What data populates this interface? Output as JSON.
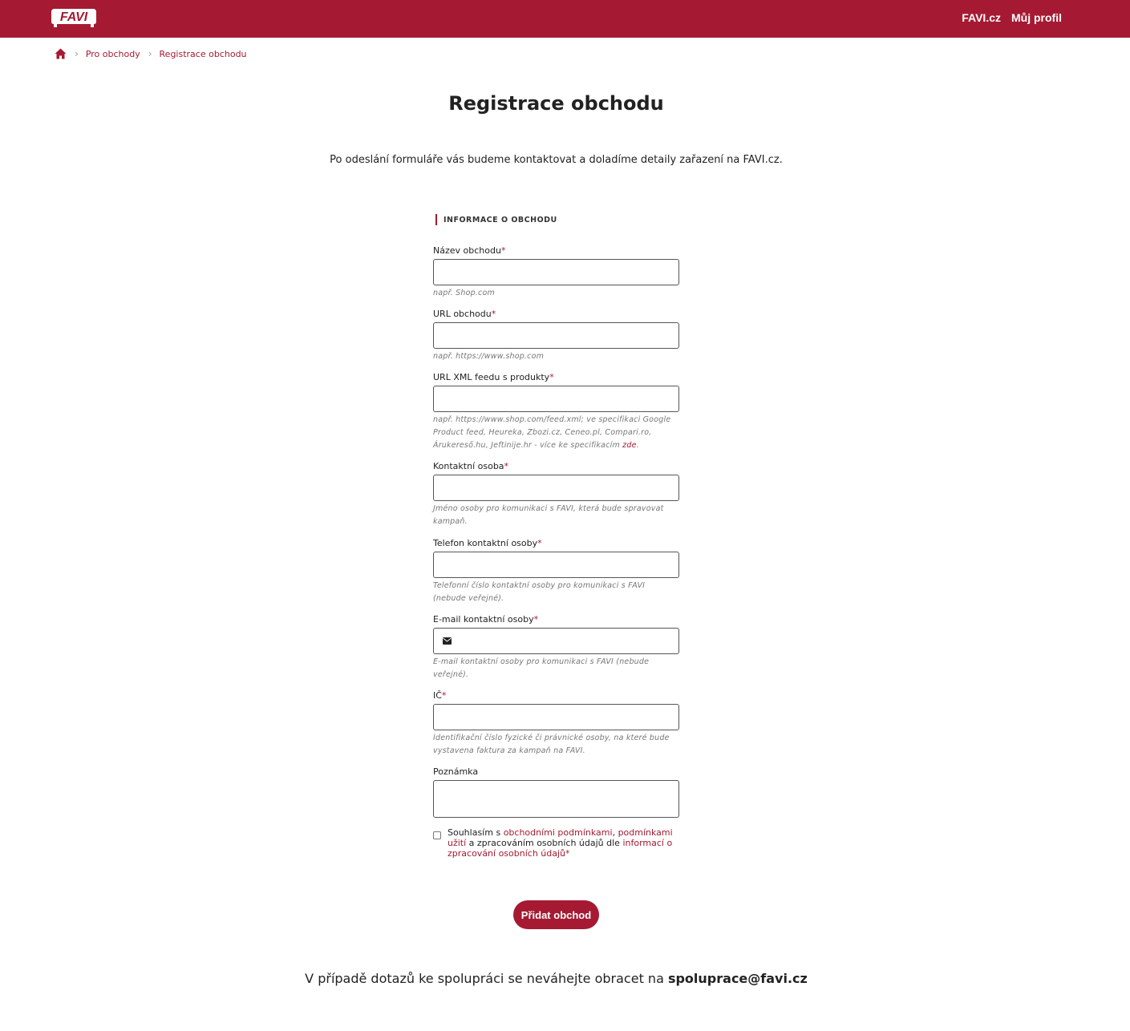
{
  "header": {
    "logo_text": "FAVI",
    "links": [
      "FAVI.cz",
      "Můj profil"
    ],
    "brand_color": "#a51a32"
  },
  "breadcrumb": {
    "home_icon": "home-icon",
    "items": [
      "Pro obchody",
      "Registrace obchodu"
    ]
  },
  "page": {
    "title": "Registrace obchodu",
    "intro": "Po odeslání formuláře vás budeme kontaktovat a doladíme detaily zařazení na FAVI.cz."
  },
  "form": {
    "section_title": "INFORMACE O OBCHODU",
    "required_mark": "*",
    "fields": [
      {
        "label": "Název obchodu",
        "value": "",
        "help": "např. Shop.com"
      },
      {
        "label": "URL obchodu",
        "value": "",
        "help": "např. https://www.shop.com"
      },
      {
        "label": "URL XML feedu s produkty",
        "value": "",
        "help": "např. https://www.shop.com/feed.xml; ve specifikaci Google Product feed, Heureka, Zbozi.cz, Ceneo.pl, Compari.ro, Árukereső.hu, Jeftinije.hr - více ke specifikacím ",
        "help_link": "zde",
        "help_end": "."
      },
      {
        "label": "Kontaktní osoba",
        "value": "",
        "help": "Jméno osoby pro komunikaci s FAVI, která bude spravovat kampaň."
      },
      {
        "label": "Telefon kontaktní osoby",
        "value": "",
        "help": "Telefonní číslo kontaktní osoby pro komunikaci s FAVI (nebude veřejné)."
      },
      {
        "label": "E-mail kontaktní osoby",
        "value": "",
        "icon": "envelope-icon",
        "help": "E-mail kontaktní osoby pro komunikaci s FAVI (nebude veřejné)."
      },
      {
        "label": "IČ",
        "value": "",
        "help": "Identifikační číslo fyzické či právnické osoby, na které bude vystavena faktura za kampaň na FAVI."
      },
      {
        "label": "Poznámka",
        "value": ""
      }
    ],
    "consent": {
      "checked": false,
      "t1": "Souhlasím s ",
      "link1": "obchodními podmínkami",
      "t2": ", ",
      "link2": "podmínkami užití",
      "t3": " a zpracováním osobních údajů dle ",
      "link3": "informací o zpracování osobních údajů",
      "t4": "*"
    },
    "submit_label": "Přidat obchod"
  },
  "footer": {
    "text": "V případě dotazů ke spolupráci se neváhejte obracet na ",
    "email": "spoluprace@favi.cz"
  }
}
